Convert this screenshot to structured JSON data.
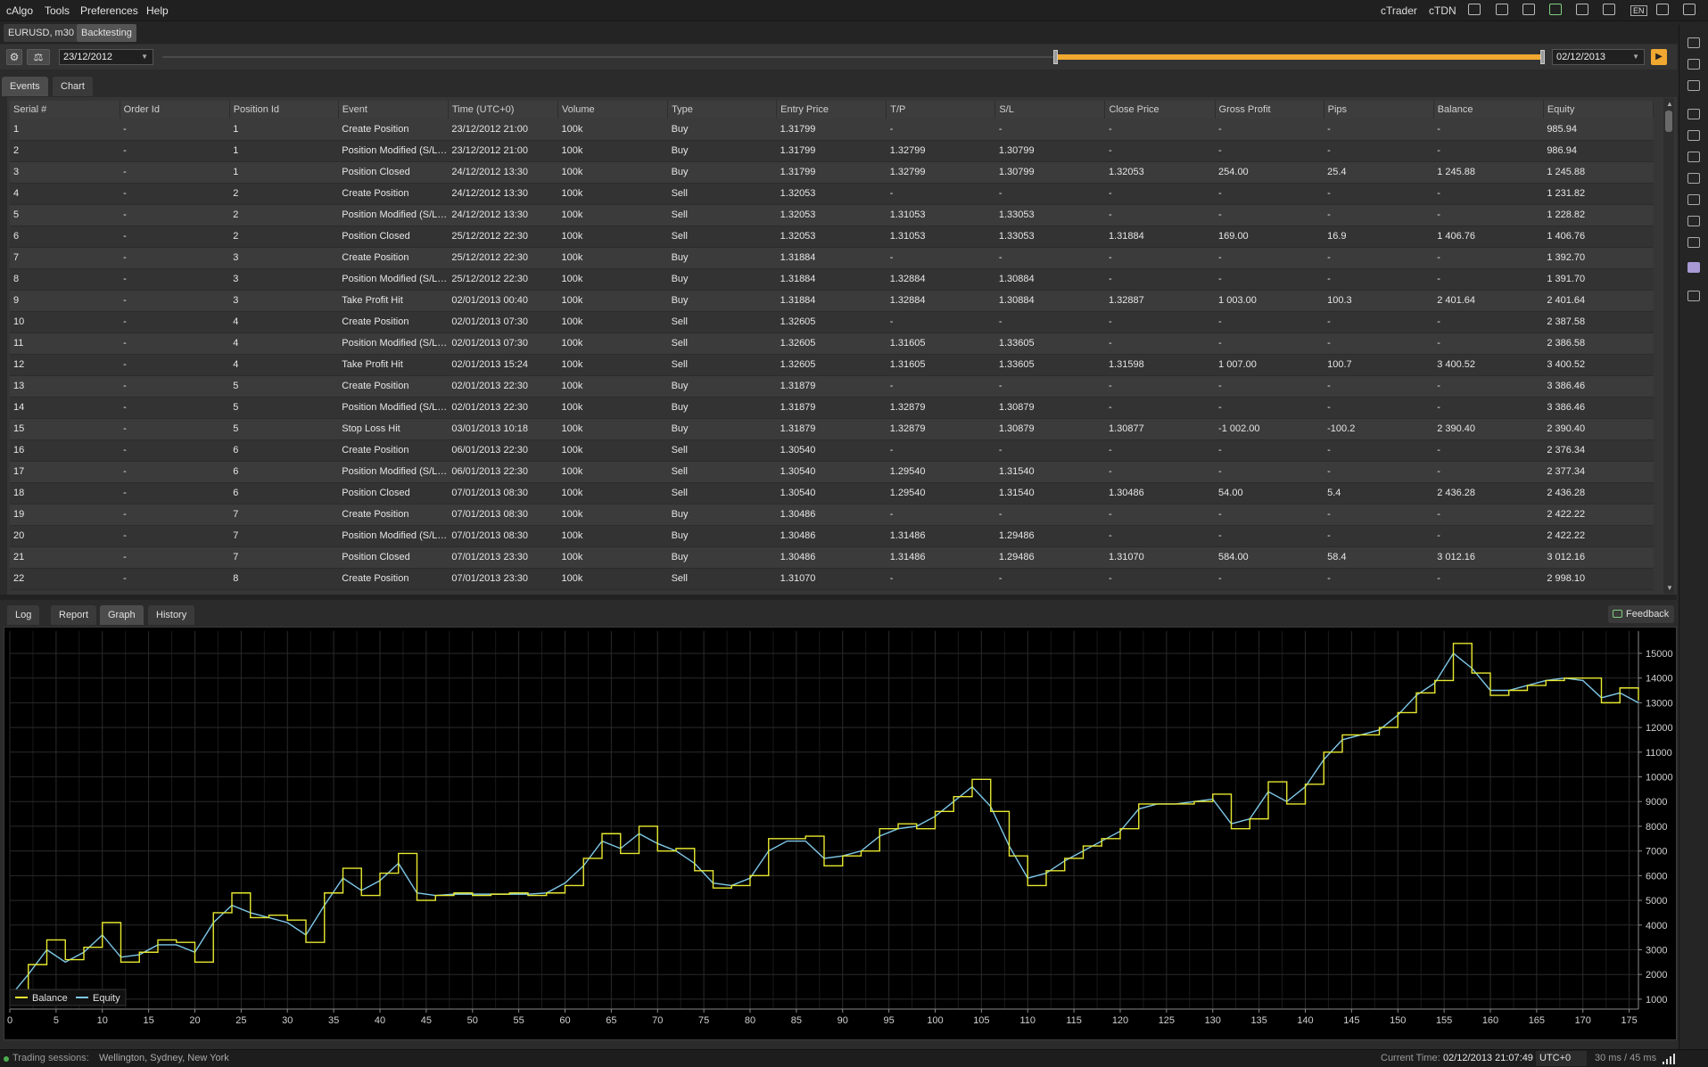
{
  "menu": [
    "cAlgo",
    "Tools",
    "Preferences",
    "Help"
  ],
  "top_right": {
    "ctrader": "cTrader",
    "ctdn": "cTDN",
    "lang": "EN"
  },
  "doc_tabs": [
    {
      "label": "EURUSD, m30"
    },
    {
      "label": "Backtesting"
    }
  ],
  "toolbar": {
    "start_date": "23/12/2012",
    "end_date": "02/12/2013",
    "play": "▶",
    "settings": "⚙"
  },
  "events_tabs": [
    "Events",
    "Chart"
  ],
  "table": {
    "columns": [
      "Serial #",
      "Order Id",
      "Position Id",
      "Event",
      "Time (UTC+0)",
      "Volume",
      "Type",
      "Entry Price",
      "T/P",
      "S/L",
      "Close Price",
      "Gross Profit",
      "Pips",
      "Balance",
      "Equity"
    ],
    "rows": [
      [
        "1",
        "-",
        "1",
        "Create Position",
        "23/12/2012 21:00",
        "100k",
        "Buy",
        "1.31799",
        "-",
        "-",
        "-",
        "-",
        "-",
        "-",
        "985.94"
      ],
      [
        "2",
        "-",
        "1",
        "Position Modified (S/L,...",
        "23/12/2012 21:00",
        "100k",
        "Buy",
        "1.31799",
        "1.32799",
        "1.30799",
        "-",
        "-",
        "-",
        "-",
        "986.94"
      ],
      [
        "3",
        "-",
        "1",
        "Position Closed",
        "24/12/2012 13:30",
        "100k",
        "Buy",
        "1.31799",
        "1.32799",
        "1.30799",
        "1.32053",
        "254.00",
        "25.4",
        "1 245.88",
        "1 245.88"
      ],
      [
        "4",
        "-",
        "2",
        "Create Position",
        "24/12/2012 13:30",
        "100k",
        "Sell",
        "1.32053",
        "-",
        "-",
        "-",
        "-",
        "-",
        "-",
        "1 231.82"
      ],
      [
        "5",
        "-",
        "2",
        "Position Modified (S/L,...",
        "24/12/2012 13:30",
        "100k",
        "Sell",
        "1.32053",
        "1.31053",
        "1.33053",
        "-",
        "-",
        "-",
        "-",
        "1 228.82"
      ],
      [
        "6",
        "-",
        "2",
        "Position Closed",
        "25/12/2012 22:30",
        "100k",
        "Sell",
        "1.32053",
        "1.31053",
        "1.33053",
        "1.31884",
        "169.00",
        "16.9",
        "1 406.76",
        "1 406.76"
      ],
      [
        "7",
        "-",
        "3",
        "Create Position",
        "25/12/2012 22:30",
        "100k",
        "Buy",
        "1.31884",
        "-",
        "-",
        "-",
        "-",
        "-",
        "-",
        "1 392.70"
      ],
      [
        "8",
        "-",
        "3",
        "Position Modified (S/L,...",
        "25/12/2012 22:30",
        "100k",
        "Buy",
        "1.31884",
        "1.32884",
        "1.30884",
        "-",
        "-",
        "-",
        "-",
        "1 391.70"
      ],
      [
        "9",
        "-",
        "3",
        "Take Profit Hit",
        "02/01/2013 00:40",
        "100k",
        "Buy",
        "1.31884",
        "1.32884",
        "1.30884",
        "1.32887",
        "1 003.00",
        "100.3",
        "2 401.64",
        "2 401.64"
      ],
      [
        "10",
        "-",
        "4",
        "Create Position",
        "02/01/2013 07:30",
        "100k",
        "Sell",
        "1.32605",
        "-",
        "-",
        "-",
        "-",
        "-",
        "-",
        "2 387.58"
      ],
      [
        "11",
        "-",
        "4",
        "Position Modified (S/L,...",
        "02/01/2013 07:30",
        "100k",
        "Sell",
        "1.32605",
        "1.31605",
        "1.33605",
        "-",
        "-",
        "-",
        "-",
        "2 386.58"
      ],
      [
        "12",
        "-",
        "4",
        "Take Profit Hit",
        "02/01/2013 15:24",
        "100k",
        "Sell",
        "1.32605",
        "1.31605",
        "1.33605",
        "1.31598",
        "1 007.00",
        "100.7",
        "3 400.52",
        "3 400.52"
      ],
      [
        "13",
        "-",
        "5",
        "Create Position",
        "02/01/2013 22:30",
        "100k",
        "Buy",
        "1.31879",
        "-",
        "-",
        "-",
        "-",
        "-",
        "-",
        "3 386.46"
      ],
      [
        "14",
        "-",
        "5",
        "Position Modified (S/L,...",
        "02/01/2013 22:30",
        "100k",
        "Buy",
        "1.31879",
        "1.32879",
        "1.30879",
        "-",
        "-",
        "-",
        "-",
        "3 386.46"
      ],
      [
        "15",
        "-",
        "5",
        "Stop Loss Hit",
        "03/01/2013 10:18",
        "100k",
        "Buy",
        "1.31879",
        "1.32879",
        "1.30879",
        "1.30877",
        "-1 002.00",
        "-100.2",
        "2 390.40",
        "2 390.40"
      ],
      [
        "16",
        "-",
        "6",
        "Create Position",
        "06/01/2013 22:30",
        "100k",
        "Sell",
        "1.30540",
        "-",
        "-",
        "-",
        "-",
        "-",
        "-",
        "2 376.34"
      ],
      [
        "17",
        "-",
        "6",
        "Position Modified (S/L,...",
        "06/01/2013 22:30",
        "100k",
        "Sell",
        "1.30540",
        "1.29540",
        "1.31540",
        "-",
        "-",
        "-",
        "-",
        "2 377.34"
      ],
      [
        "18",
        "-",
        "6",
        "Position Closed",
        "07/01/2013 08:30",
        "100k",
        "Sell",
        "1.30540",
        "1.29540",
        "1.31540",
        "1.30486",
        "54.00",
        "5.4",
        "2 436.28",
        "2 436.28"
      ],
      [
        "19",
        "-",
        "7",
        "Create Position",
        "07/01/2013 08:30",
        "100k",
        "Buy",
        "1.30486",
        "-",
        "-",
        "-",
        "-",
        "-",
        "-",
        "2 422.22"
      ],
      [
        "20",
        "-",
        "7",
        "Position Modified (S/L,...",
        "07/01/2013 08:30",
        "100k",
        "Buy",
        "1.30486",
        "1.31486",
        "1.29486",
        "-",
        "-",
        "-",
        "-",
        "2 422.22"
      ],
      [
        "21",
        "-",
        "7",
        "Position Closed",
        "07/01/2013 23:30",
        "100k",
        "Buy",
        "1.30486",
        "1.31486",
        "1.29486",
        "1.31070",
        "584.00",
        "58.4",
        "3 012.16",
        "3 012.16"
      ],
      [
        "22",
        "-",
        "8",
        "Create Position",
        "07/01/2013 23:30",
        "100k",
        "Sell",
        "1.31070",
        "-",
        "-",
        "-",
        "-",
        "-",
        "-",
        "2 998.10"
      ]
    ]
  },
  "bottom_tabs": [
    "Log",
    "Report",
    "Graph",
    "History"
  ],
  "feedback_label": "Feedback",
  "chart_data": {
    "type": "line",
    "x_ticks": [
      0,
      5,
      10,
      15,
      20,
      25,
      30,
      35,
      40,
      45,
      50,
      55,
      60,
      65,
      70,
      75,
      80,
      85,
      90,
      95,
      100,
      105,
      110,
      115,
      120,
      125,
      130,
      135,
      140,
      145,
      150,
      155,
      160,
      165,
      170,
      175
    ],
    "y_ticks": [
      1000,
      2000,
      3000,
      4000,
      5000,
      6000,
      7000,
      8000,
      9000,
      10000,
      11000,
      12000,
      13000,
      14000,
      15000
    ],
    "xlim": [
      0,
      176
    ],
    "ylim": [
      600,
      15900
    ],
    "grid": true,
    "legend_position": "bottom-left",
    "colors": {
      "balance": "#e8e830",
      "equity": "#7ec8e8"
    },
    "series": [
      {
        "name": "Balance",
        "x": [
          0,
          2,
          4,
          6,
          8,
          10,
          12,
          14,
          16,
          18,
          20,
          22,
          24,
          26,
          28,
          30,
          32,
          34,
          36,
          38,
          40,
          42,
          44,
          46,
          48,
          50,
          52,
          54,
          56,
          58,
          60,
          62,
          64,
          66,
          68,
          70,
          72,
          74,
          76,
          78,
          80,
          82,
          84,
          86,
          88,
          90,
          92,
          94,
          96,
          98,
          100,
          102,
          104,
          106,
          108,
          110,
          112,
          114,
          116,
          118,
          120,
          122,
          124,
          126,
          128,
          130,
          132,
          134,
          136,
          138,
          140,
          142,
          144,
          146,
          148,
          150,
          152,
          154,
          156,
          158,
          160,
          162,
          164,
          166,
          168,
          170,
          172,
          174,
          176
        ],
        "y": [
          1000,
          2400,
          3400,
          2600,
          3100,
          4100,
          2500,
          2900,
          3400,
          3300,
          2500,
          4500,
          5300,
          4300,
          4400,
          4200,
          3300,
          5300,
          6300,
          5200,
          6100,
          6900,
          5000,
          5200,
          5300,
          5200,
          5250,
          5300,
          5200,
          5300,
          5600,
          6700,
          7700,
          6900,
          8000,
          7000,
          7100,
          6200,
          5500,
          5600,
          6000,
          7500,
          7500,
          7600,
          6400,
          6800,
          7000,
          7900,
          8100,
          7900,
          8600,
          9200,
          9900,
          8600,
          6800,
          5600,
          6200,
          6700,
          7200,
          7500,
          7900,
          8900,
          8900,
          8900,
          9000,
          9300,
          7900,
          8300,
          9800,
          8900,
          9700,
          11000,
          11700,
          11700,
          12000,
          12600,
          13400,
          13900,
          15400,
          14200,
          13300,
          13500,
          13700,
          13900,
          14000,
          14000,
          13000,
          13600,
          13100
        ]
      },
      {
        "name": "Equity",
        "x": [
          0,
          2,
          4,
          6,
          8,
          10,
          12,
          14,
          16,
          18,
          20,
          22,
          24,
          26,
          28,
          30,
          32,
          34,
          36,
          38,
          40,
          42,
          44,
          46,
          48,
          50,
          52,
          54,
          56,
          58,
          60,
          62,
          64,
          66,
          68,
          70,
          72,
          74,
          76,
          78,
          80,
          82,
          84,
          86,
          88,
          90,
          92,
          94,
          96,
          98,
          100,
          102,
          104,
          106,
          108,
          110,
          112,
          114,
          116,
          118,
          120,
          122,
          124,
          126,
          128,
          130,
          132,
          134,
          136,
          138,
          140,
          142,
          144,
          146,
          148,
          150,
          152,
          154,
          156,
          158,
          160,
          162,
          164,
          166,
          168,
          170,
          172,
          174,
          176
        ],
        "y": [
          1100,
          2000,
          3000,
          2500,
          2900,
          3600,
          2700,
          2800,
          3200,
          3200,
          2900,
          4100,
          4800,
          4500,
          4300,
          4100,
          3600,
          4800,
          5900,
          5400,
          5800,
          6500,
          5300,
          5200,
          5250,
          5250,
          5250,
          5250,
          5250,
          5300,
          5700,
          6400,
          7400,
          7100,
          7700,
          7300,
          7000,
          6500,
          5700,
          5600,
          5900,
          7000,
          7400,
          7400,
          6700,
          6800,
          7000,
          7600,
          7900,
          8000,
          8400,
          9000,
          9600,
          8800,
          7200,
          5900,
          6100,
          6600,
          7000,
          7400,
          7800,
          8700,
          8900,
          8900,
          9000,
          9100,
          8100,
          8300,
          9400,
          9000,
          9600,
          10700,
          11500,
          11700,
          11900,
          12500,
          13300,
          13800,
          15000,
          14400,
          13500,
          13500,
          13700,
          13900,
          14000,
          13900,
          13200,
          13400,
          13000
        ]
      }
    ]
  },
  "status": {
    "sessions_label": "Trading sessions:",
    "sessions": "Wellington, Sydney, New York",
    "current_time_label": "Current Time:",
    "current_time": "02/12/2013 21:07:49",
    "tz": "UTC+0",
    "latency": "30 ms / 45 ms"
  }
}
